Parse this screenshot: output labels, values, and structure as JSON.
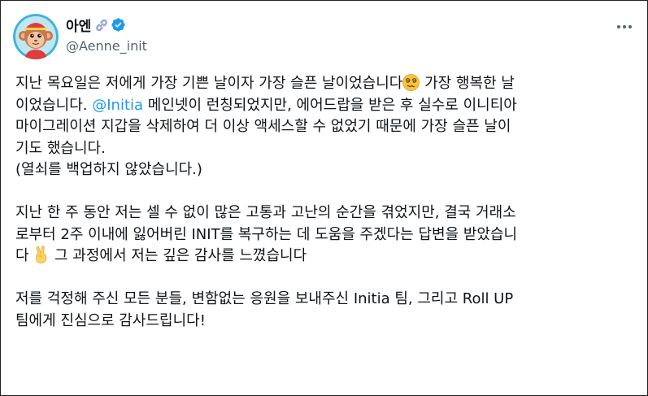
{
  "tweet": {
    "author": {
      "display_name": "아엔",
      "handle": "@Aenne_init"
    },
    "icons": {
      "chain": "link-chain-icon",
      "verified": "verified-badge-icon",
      "more": "more-options-icon",
      "emoji_face": "dizzy-face-emoji",
      "emoji_hand": "victory-hand-emoji"
    },
    "colors": {
      "mention": "#1d9bf0",
      "verified": "#1d9bf0",
      "handle": "#536471"
    },
    "body": {
      "p1": {
        "l1_a": "지난 목요일은 저에게 가장 기쁜 날이자 가장 슬픈 날이었습니다",
        "l1_b": " 가장 행복한 날",
        "l2_a": "이었습니다. ",
        "mention": "@Initia",
        "l2_b": " 메인넷이 런칭되었지만, 에어드랍을 받은 후 실수로 이니티아",
        "l3": "마이그레이션 지갑을 삭제하여 더 이상 액세스할 수 없었기 때문에 가장 슬픈 날이",
        "l4": "기도 했습니다.",
        "l5": " (열쇠를 백업하지 않았습니다.)"
      },
      "p2": {
        "l1": "지난 한 주 동안 저는 셀 수 없이 많은 고통과 고난의 순간을 겪었지만, 결국 거래소",
        "l2": "로부터 2주 이내에 잃어버린 INIT를 복구하는 데 도움을 주겠다는 답변을 받았습니",
        "l3_a": "다 ",
        "l3_b": " 그 과정에서 저는 깊은 감사를 느꼈습니다"
      },
      "p3": {
        "l1": "저를 걱정해 주신 모든 분들, 변함없는 응원을 보내주신 Initia 팀, 그리고 Roll UP",
        "l2": "팀에게 진심으로 감사드립니다!"
      }
    }
  }
}
